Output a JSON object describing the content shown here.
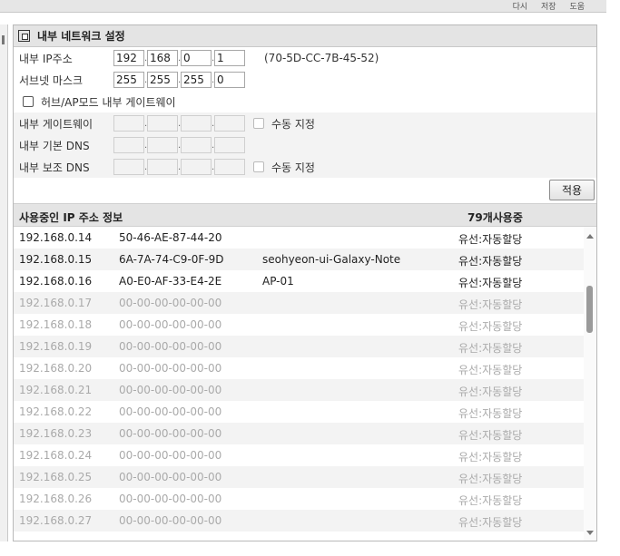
{
  "top_links": [
    "다시",
    "저장",
    "도움"
  ],
  "panel": {
    "title": "내부 네트워크 설정",
    "ip": {
      "label": "내부 IP주소",
      "octets": [
        "192",
        "168",
        "0",
        "1"
      ],
      "mac": "(70-5D-CC-7B-45-52)"
    },
    "subnet": {
      "label": "서브넷 마스크",
      "octets": [
        "255",
        "255",
        "255",
        "0"
      ]
    },
    "hub_ap": {
      "label": "허브/AP모드 내부 게이트웨이",
      "checked": false
    },
    "gateway": {
      "label": "내부 게이트웨이",
      "manual_label": "수동 지정"
    },
    "dns1": {
      "label": "내부 기본 DNS"
    },
    "dns2": {
      "label": "내부 보조 DNS",
      "manual_label": "수동 지정"
    },
    "apply_label": "적용"
  },
  "ip_list": {
    "title": "사용중인 IP 주소 정보",
    "count": "79개사용중",
    "rows": [
      {
        "ip": "192.168.0.14",
        "mac": "50-46-AE-87-44-20",
        "name": "",
        "type": "유선:자동할당",
        "active": true
      },
      {
        "ip": "192.168.0.15",
        "mac": "6A-7A-74-C9-0F-9D",
        "name": "seohyeon-ui-Galaxy-Note",
        "type": "유선:자동할당",
        "active": true
      },
      {
        "ip": "192.168.0.16",
        "mac": "A0-E0-AF-33-E4-2E",
        "name": "AP-01",
        "type": "유선:자동할당",
        "active": true
      },
      {
        "ip": "192.168.0.17",
        "mac": "00-00-00-00-00-00",
        "name": "",
        "type": "유선:자동할당",
        "active": false
      },
      {
        "ip": "192.168.0.18",
        "mac": "00-00-00-00-00-00",
        "name": "",
        "type": "유선:자동할당",
        "active": false
      },
      {
        "ip": "192.168.0.19",
        "mac": "00-00-00-00-00-00",
        "name": "",
        "type": "유선:자동할당",
        "active": false
      },
      {
        "ip": "192.168.0.20",
        "mac": "00-00-00-00-00-00",
        "name": "",
        "type": "유선:자동할당",
        "active": false
      },
      {
        "ip": "192.168.0.21",
        "mac": "00-00-00-00-00-00",
        "name": "",
        "type": "유선:자동할당",
        "active": false
      },
      {
        "ip": "192.168.0.22",
        "mac": "00-00-00-00-00-00",
        "name": "",
        "type": "유선:자동할당",
        "active": false
      },
      {
        "ip": "192.168.0.23",
        "mac": "00-00-00-00-00-00",
        "name": "",
        "type": "유선:자동할당",
        "active": false
      },
      {
        "ip": "192.168.0.24",
        "mac": "00-00-00-00-00-00",
        "name": "",
        "type": "유선:자동할당",
        "active": false
      },
      {
        "ip": "192.168.0.25",
        "mac": "00-00-00-00-00-00",
        "name": "",
        "type": "유선:자동할당",
        "active": false
      },
      {
        "ip": "192.168.0.26",
        "mac": "00-00-00-00-00-00",
        "name": "",
        "type": "유선:자동할당",
        "active": false
      },
      {
        "ip": "192.168.0.27",
        "mac": "00-00-00-00-00-00",
        "name": "",
        "type": "유선:자동할당",
        "active": false
      }
    ]
  }
}
